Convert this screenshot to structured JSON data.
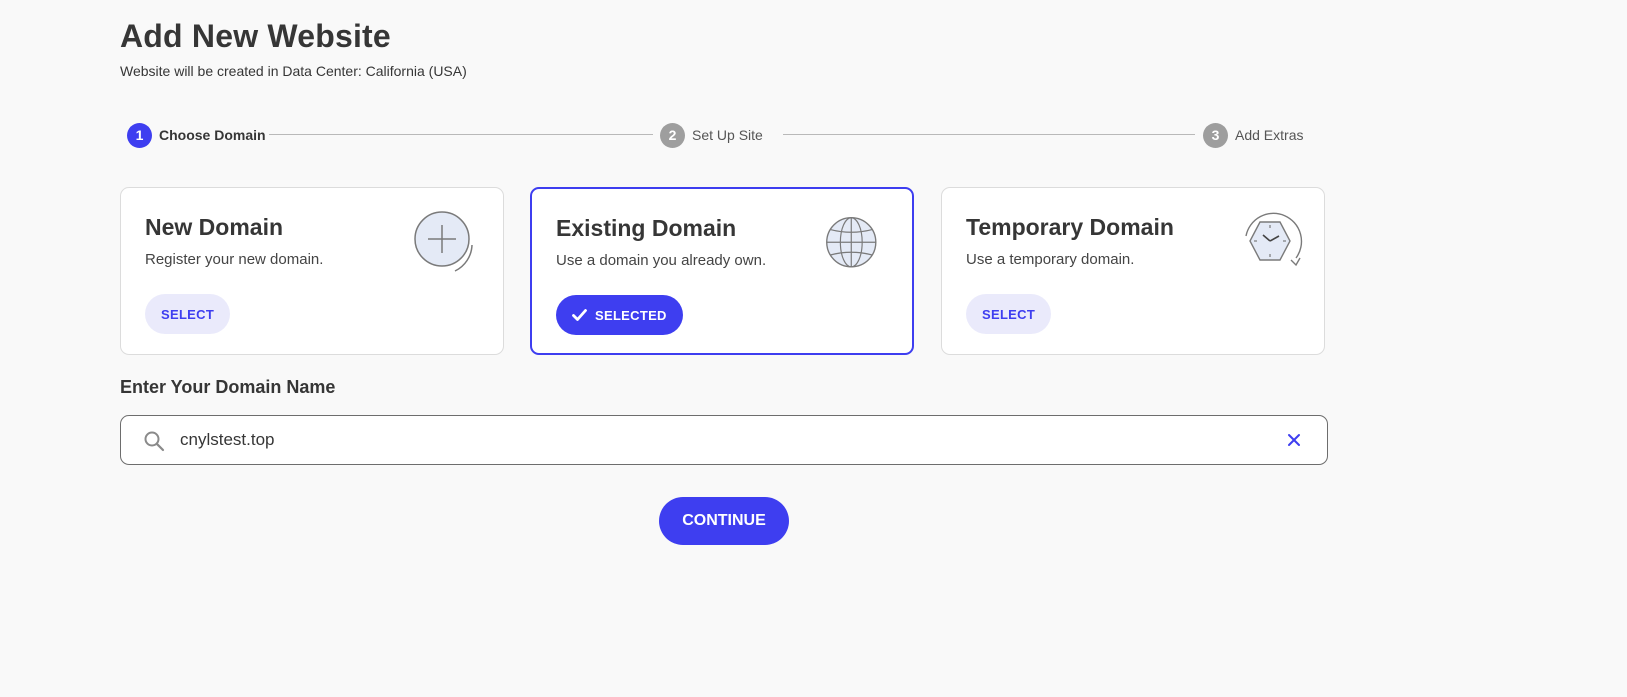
{
  "header": {
    "title": "Add New Website",
    "subtitle": "Website will be created in Data Center: California (USA)"
  },
  "stepper": {
    "steps": [
      {
        "number": "1",
        "label": "Choose Domain",
        "active": true
      },
      {
        "number": "2",
        "label": "Set Up Site",
        "active": false
      },
      {
        "number": "3",
        "label": "Add Extras",
        "active": false
      }
    ]
  },
  "cards": [
    {
      "title": "New Domain",
      "description": "Register your new domain.",
      "button_label": "SELECT",
      "icon": "plus-circle-icon",
      "selected": false
    },
    {
      "title": "Existing Domain",
      "description": "Use a domain you already own.",
      "button_label": "SELECTED",
      "icon": "globe-icon",
      "selected": true
    },
    {
      "title": "Temporary Domain",
      "description": "Use a temporary domain.",
      "button_label": "SELECT",
      "icon": "clock-icon",
      "selected": false
    }
  ],
  "domain": {
    "label": "Enter Your Domain Name",
    "value": "cnylstest.top",
    "search_icon": "search-icon",
    "clear_icon": "close-icon"
  },
  "actions": {
    "continue_label": "CONTINUE"
  },
  "colors": {
    "accent": "#3e3ef0",
    "accent_light": "#eaeafb",
    "inactive_step": "#9e9e9e",
    "background": "#f9f9f9"
  }
}
